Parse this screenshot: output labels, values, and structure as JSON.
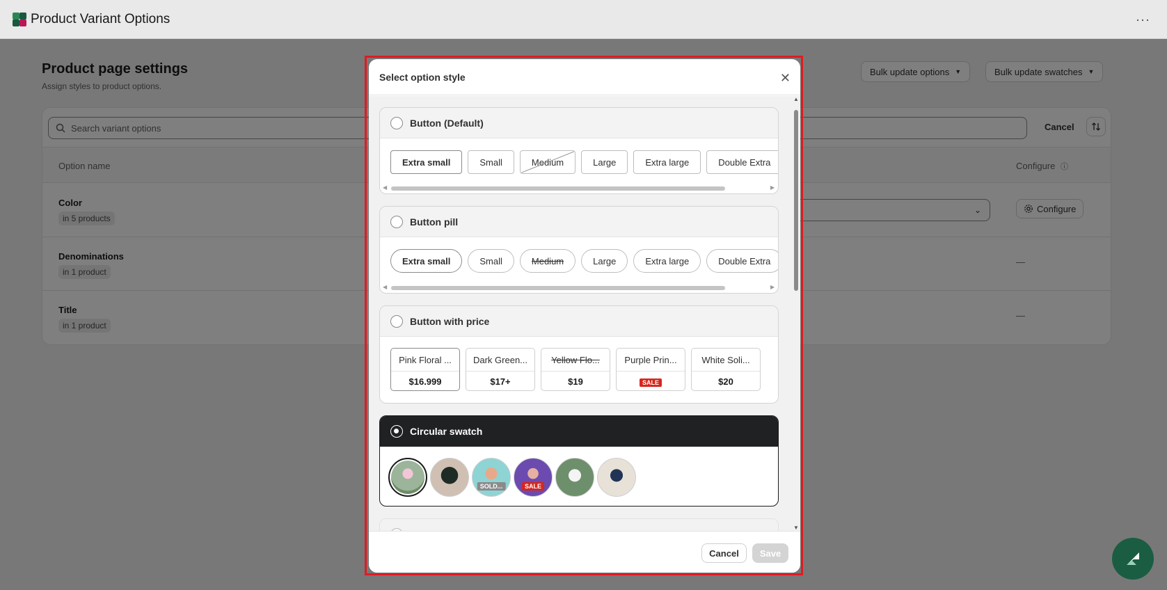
{
  "app": {
    "title": "Product Variant Options",
    "more_label": "···"
  },
  "page": {
    "title": "Product page settings",
    "subtitle": "Assign styles to product options.",
    "bulk_options_label": "Bulk update options",
    "bulk_swatches_label": "Bulk update swatches"
  },
  "table": {
    "search_placeholder": "Search variant options",
    "cancel_label": "Cancel",
    "col_option_name": "Option name",
    "col_configure": "Configure",
    "rows": [
      {
        "name": "Color",
        "count": "in 5 products",
        "action": "Configure"
      },
      {
        "name": "Denominations",
        "count": "in 1 product",
        "action": "—"
      },
      {
        "name": "Title",
        "count": "in 1 product",
        "action": "—"
      }
    ]
  },
  "modal": {
    "title": "Select option style",
    "cancel_label": "Cancel",
    "save_label": "Save",
    "options": [
      {
        "label": "Button (Default)",
        "selected": false,
        "chips": [
          "Extra small",
          "Small",
          "Medium",
          "Large",
          "Extra large",
          "Double Extra"
        ]
      },
      {
        "label": "Button pill",
        "selected": false,
        "chips": [
          "Extra small",
          "Small",
          "Medium",
          "Large",
          "Extra large",
          "Double Extra"
        ]
      },
      {
        "label": "Button with price",
        "selected": false,
        "cards": [
          {
            "name": "Pink Floral ...",
            "price": "$16.999"
          },
          {
            "name": "Dark Green...",
            "price": "$17+"
          },
          {
            "name": "Yellow Flo...",
            "price": "$19"
          },
          {
            "name": "Purple Prin...",
            "price": "SALE"
          },
          {
            "name": "White Soli...",
            "price": "$20"
          }
        ]
      },
      {
        "label": "Circular swatch",
        "selected": true,
        "badges": [
          "SOLD...",
          "SALE"
        ]
      }
    ]
  },
  "colors": {
    "accent_red": "#e11b22",
    "selected_dark": "#202123",
    "sale_red": "#d7261e",
    "fab_green": "#1a5d43"
  }
}
